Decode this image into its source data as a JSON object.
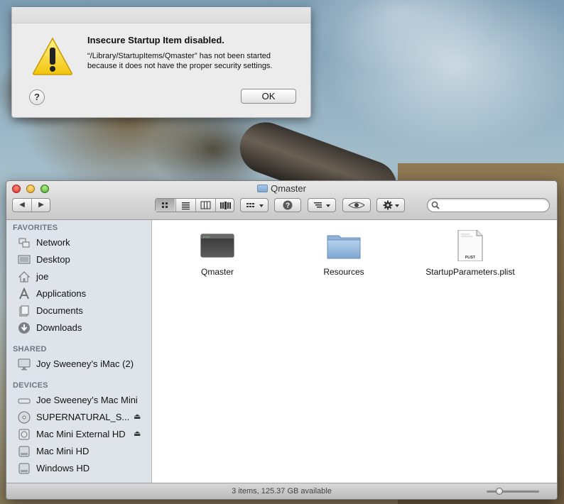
{
  "alert": {
    "title": "Insecure Startup Item disabled.",
    "message": "“/Library/StartupItems/Qmaster” has not been started because it does not have the proper security settings.",
    "help_label": "?",
    "ok_label": "OK",
    "icon": "warning-icon"
  },
  "window": {
    "title": "Qmaster"
  },
  "toolbar": {
    "back_icon": "◀",
    "forward_icon": "▶",
    "view_modes": [
      "icon-view-icon",
      "list-view-icon",
      "column-view-icon",
      "coverflow-view-icon"
    ],
    "active_view": "icon",
    "arrange_icon": "arrange-icon",
    "info_icon": "info-icon",
    "sort_icon": "sort-icon",
    "quicklook_icon": "eye-icon",
    "action_icon": "gear-icon",
    "search_placeholder": ""
  },
  "sidebar": {
    "favorites_header": "FAVORITES",
    "favorites": [
      {
        "label": "Network",
        "icon": "network-icon"
      },
      {
        "label": "Desktop",
        "icon": "desktop-icon"
      },
      {
        "label": "joe",
        "icon": "home-icon"
      },
      {
        "label": "Applications",
        "icon": "applications-icon"
      },
      {
        "label": "Documents",
        "icon": "documents-icon"
      },
      {
        "label": "Downloads",
        "icon": "downloads-icon"
      }
    ],
    "shared_header": "SHARED",
    "shared": [
      {
        "label": "Joy Sweeney’s iMac (2)",
        "icon": "imac-icon"
      }
    ],
    "devices_header": "DEVICES",
    "devices": [
      {
        "label": "Joe Sweeney’s Mac Mini",
        "icon": "mac-mini-icon"
      },
      {
        "label": "SUPERNATURAL_S...",
        "icon": "disc-icon",
        "eject": "⏏"
      },
      {
        "label": "Mac Mini External HD",
        "icon": "external-drive-icon",
        "eject": "⏏"
      },
      {
        "label": "Mac Mini HD",
        "icon": "hard-drive-icon"
      },
      {
        "label": "Windows HD",
        "icon": "hard-drive-icon"
      }
    ]
  },
  "files": [
    {
      "name": "Qmaster",
      "icon": "executable-icon"
    },
    {
      "name": "Resources",
      "icon": "folder-icon"
    },
    {
      "name": "StartupParameters.plist",
      "icon": "plist-file-icon",
      "badge": "PLIST"
    }
  ],
  "statusbar": {
    "text": "3 items, 125.37 GB available",
    "icon_size_fraction": 0.2
  },
  "colors": {
    "sidebar_bg": "#dfe4ea",
    "sidebar_header": "#6f7780",
    "folder_blue": "#7ea6cf",
    "warning_yellow": "#f6d21a"
  }
}
